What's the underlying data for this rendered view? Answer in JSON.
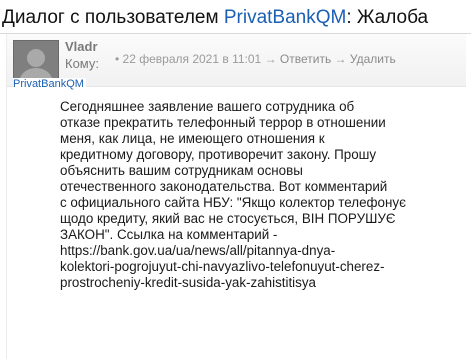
{
  "header": {
    "prefix": "Диалог с пользователем ",
    "user_link": "PrivatBankQM",
    "suffix": ": Жалоба"
  },
  "message": {
    "author": "Vladr",
    "to_label": "Кому:",
    "recipient": "PrivatBankQM",
    "date_text": "22 февраля 2021 в 11:01",
    "reply_label": "Ответить",
    "delete_label": "Удалить",
    "avatar_icon": "default-user-avatar-icon",
    "body_lines": [
      "Сегодняшнее заявление вашего сотрудника об",
      "отказе прекратить телефонный террор в отношении",
      "меня, как лица, не имеющего отношения к",
      "кредитному договору, противоречит закону. Прошу",
      "объяснить вашим сотрудникам основы",
      "отечественного законодательства. Вот комментарий",
      "с официального сайта НБУ: \"Якщо колектор телефонує",
      "щодо кредиту, який вас не стосується, ВІН ПОРУШУЄ",
      "ЗАКОН\". Ссылка на комментарий -",
      "https://bank.gov.ua/ua/news/all/pitannya-dnya-",
      "kolektori-pogrojuyut-chi-navyazlivo-telefonuyut-cherez-",
      "prostrocheniy-kredit-susida-yak-zahistitisya"
    ]
  },
  "colors": {
    "link": "#1a5fb4",
    "muted": "#7a7a7a",
    "header_bg": "#f1f1f1"
  }
}
